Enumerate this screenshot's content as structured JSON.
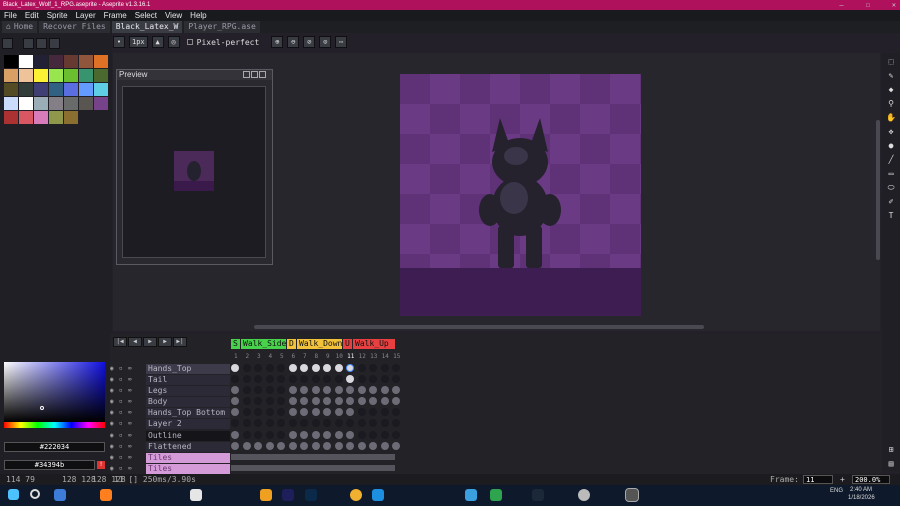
{
  "window": {
    "title": "Black_Latex_Wolf_1_RPG.aseprite - Aseprite v1.3.16.1",
    "controls": [
      "–",
      "☐",
      "✕"
    ]
  },
  "menu": [
    "File",
    "Edit",
    "Sprite",
    "Layer",
    "Frame",
    "Select",
    "View",
    "Help"
  ],
  "tabs": [
    {
      "label": "Home",
      "icon": "home-icon"
    },
    {
      "label": "Recover Files"
    },
    {
      "label": "Black_Latex_W"
    },
    {
      "label": "Player_RPG.ase"
    }
  ],
  "context": {
    "brush_size": "1px",
    "pixel_perfect": "Pixel-perfect"
  },
  "preview": {
    "title": "Preview"
  },
  "palette": [
    "#000000",
    "#ffffff",
    "#222034",
    "#45283c",
    "#663931",
    "#8f563b",
    "#df7126",
    "#d9a066",
    "#eec39a",
    "#fbf236",
    "#99e550",
    "#6abe30",
    "#37946e",
    "#4b692f",
    "#524b24",
    "#323c39",
    "#3f3f74",
    "#306082",
    "#5b6ee1",
    "#639bff",
    "#5fcde4",
    "#cbdbfc",
    "#ffffff",
    "#9badb7",
    "#847e87",
    "#696a6a",
    "#595652",
    "#76428a",
    "#ac3232",
    "#d95763",
    "#d77bba",
    "#8f974a",
    "#8a6f30"
  ],
  "colors": {
    "fg_hex": "#222034",
    "bg_hex": "#34394b"
  },
  "timeline": {
    "tags": [
      {
        "label": "S",
        "color": "#48d14a"
      },
      {
        "label": "Walk_Side",
        "color": "#48d14a"
      },
      {
        "label": "D",
        "color": "#f2c33a"
      },
      {
        "label": "Walk_Down",
        "color": "#f2c33a"
      },
      {
        "label": "U",
        "color": "#e84040"
      },
      {
        "label": "Walk_Up",
        "color": "#e84040"
      }
    ],
    "frames": [
      "1",
      "2",
      "3",
      "4",
      "5",
      "6",
      "7",
      "8",
      "9",
      "10",
      "11",
      "12",
      "13",
      "14",
      "15"
    ],
    "layers": [
      "Hands_Top",
      "Tail",
      "Legs",
      "Body",
      "Hands_Top Bottom",
      "Layer 2",
      "Outline",
      "Flattened",
      "Tiles",
      "Tiles"
    ]
  },
  "status": {
    "position": "114 79",
    "size1": "128 128",
    "size2": "128 128",
    "frame_info": "11 [] 250ms/3.90s",
    "frame_label": "Frame:",
    "frame_value": "11",
    "zoom": "200.0%"
  },
  "taskbar": {
    "lang": "ENG",
    "time": "2:40 AM",
    "date": "1/18/2026"
  }
}
